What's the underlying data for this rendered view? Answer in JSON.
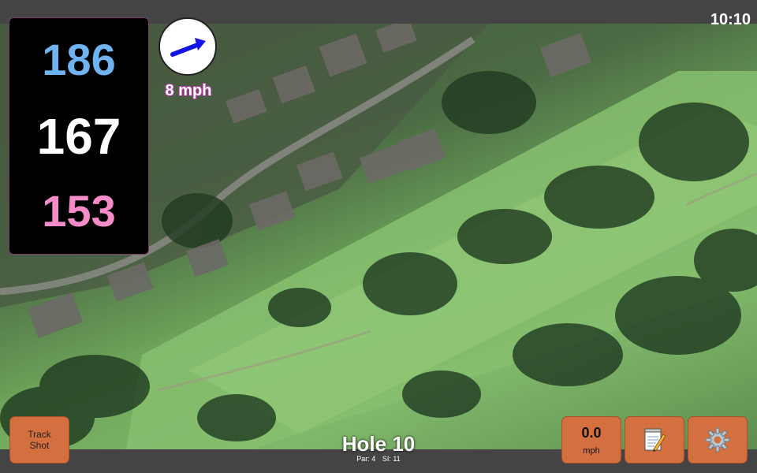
{
  "status_bar": {
    "time": "10:10"
  },
  "distances": {
    "back": "186",
    "middle": "167",
    "front": "153",
    "colors": {
      "back": "#6fb3f0",
      "middle": "#ffffff",
      "front": "#f58bc8"
    }
  },
  "wind": {
    "speed_label": "8 mph",
    "arrow_color": "#1414e6",
    "icon": "wind-direction-arrow-icon"
  },
  "buttons": {
    "track_shot": {
      "line1": "Track",
      "line2": "Shot"
    },
    "speed": {
      "value": "0.0",
      "unit": "mph"
    },
    "notes": {
      "icon": "notepad-pencil-icon"
    },
    "settings": {
      "icon": "gear-icon"
    },
    "color": "#d4703f"
  },
  "hole": {
    "title": "Hole 10",
    "par": "Par: 4",
    "si": "SI: 11"
  }
}
